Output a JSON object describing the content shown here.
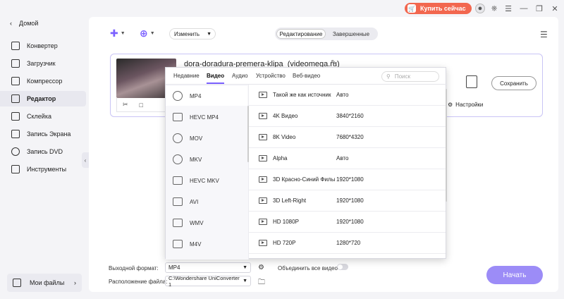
{
  "titlebar": {
    "buy_label": "Купить сейчас"
  },
  "sidebar": {
    "back_label": "Домой",
    "items": [
      {
        "label": "Конвертер"
      },
      {
        "label": "Загрузчик"
      },
      {
        "label": "Компрессор"
      },
      {
        "label": "Редактор",
        "active": true
      },
      {
        "label": "Склейка"
      },
      {
        "label": "Запись Экрана"
      },
      {
        "label": "Запись DVD"
      },
      {
        "label": "Инструменты"
      }
    ],
    "my_files_label": "Мои файлы"
  },
  "toolbar": {
    "edit_dropdown": "Изменить",
    "tabs": [
      "Редактирование",
      "Завершенные"
    ]
  },
  "file": {
    "name": "dora-doradura-premera-klipa_(videomega.ru)",
    "settings_label": "Настройки",
    "save_label": "Сохранить"
  },
  "popup": {
    "tabs": [
      "Недавние",
      "Видео",
      "Аудио",
      "Устройство",
      "Веб-видео"
    ],
    "active_tab": "Видео",
    "search_placeholder": "Поиск",
    "formats": [
      "MP4",
      "HEVC MP4",
      "MOV",
      "MKV",
      "HEVC MKV",
      "AVI",
      "WMV",
      "M4V"
    ],
    "active_format": "MP4",
    "presets": [
      {
        "name": "Такой же как источник",
        "res": "Авто"
      },
      {
        "name": "4K Видео",
        "res": "3840*2160"
      },
      {
        "name": "8K Video",
        "res": "7680*4320"
      },
      {
        "name": "Alpha",
        "res": "Авто"
      },
      {
        "name": "3D Красно-Синий Фильм",
        "res": "1920*1080"
      },
      {
        "name": "3D Left-Right",
        "res": "1920*1080"
      },
      {
        "name": "HD 1080P",
        "res": "1920*1080"
      },
      {
        "name": "HD 720P",
        "res": "1280*720"
      }
    ]
  },
  "bottom": {
    "output_format_label": "Выходной формат:",
    "output_format_value": "MP4",
    "merge_label": "Объединить все видео",
    "location_label": "Расположение файла:",
    "location_value": "C:\\Wondershare UniConverter 1",
    "start_label": "Начать"
  },
  "colors": {
    "accent": "#7b61ff",
    "buy": "#f2674f",
    "start": "#9c8cf7"
  }
}
